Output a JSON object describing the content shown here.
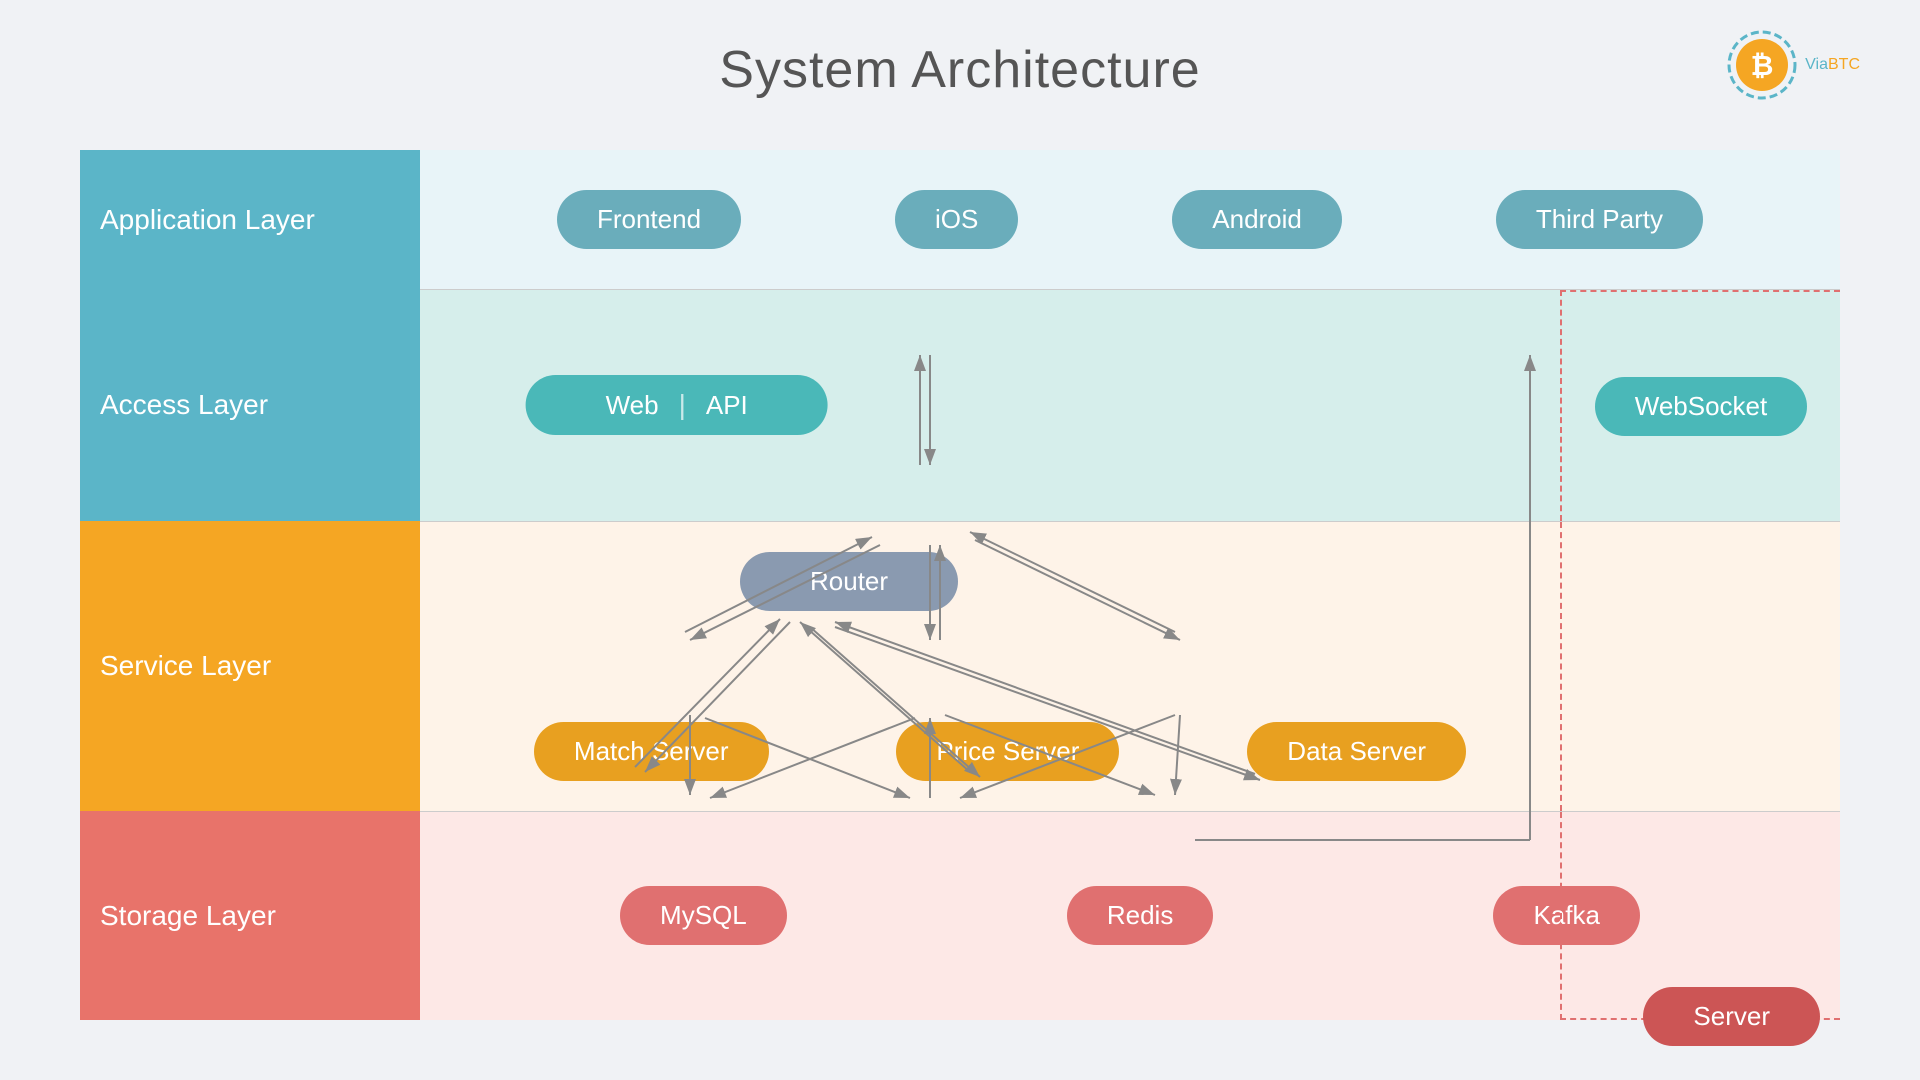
{
  "title": "System Architecture",
  "logo": {
    "via": "Via",
    "btc": "BTC"
  },
  "layers": {
    "application": "Application Layer",
    "access": "Access Layer",
    "service": "Service Layer",
    "storage": "Storage Layer"
  },
  "app_items": [
    "Frontend",
    "iOS",
    "Android",
    "Third Party"
  ],
  "access_items": {
    "web": "Web",
    "divider": "|",
    "api": "API",
    "websocket": "WebSocket"
  },
  "service_items": {
    "router": "Router",
    "match": "Match Server",
    "price": "Price Server",
    "data": "Data Server"
  },
  "storage_items": [
    "MySQL",
    "Redis",
    "Kafka"
  ],
  "server_label": "Server"
}
